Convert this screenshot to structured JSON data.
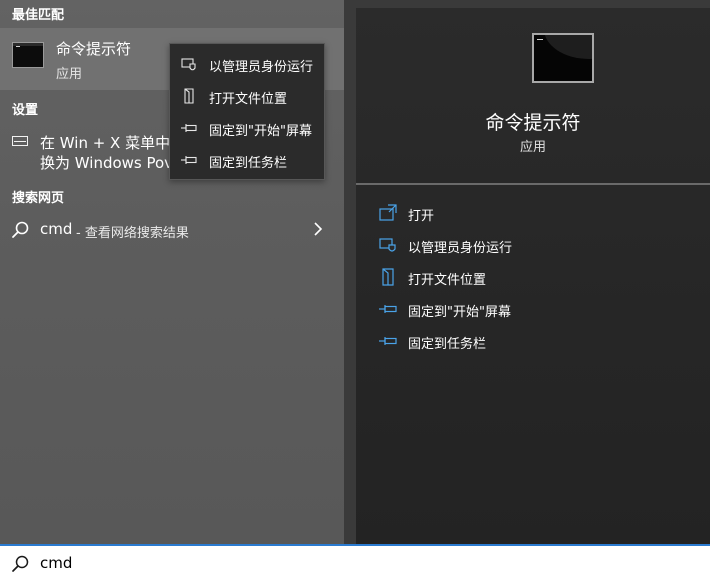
{
  "left": {
    "best_match_header": "最佳匹配",
    "best_match": {
      "title": "命令提示符",
      "subtitle": "应用",
      "icon": "command-prompt-icon"
    },
    "settings_header": "设置",
    "settings_result": {
      "line1": "在 Win + X 菜单中",
      "line2": "换为 Windows Pov",
      "icon": "settings-window-icon"
    },
    "web_header": "搜索网页",
    "web_result": {
      "query": "cmd",
      "suffix": "- 查看网络搜索结果",
      "icon": "search-icon"
    }
  },
  "context_menu": {
    "items": [
      {
        "label": "以管理员身份运行",
        "icon": "shield-icon"
      },
      {
        "label": "打开文件位置",
        "icon": "file-location-icon"
      },
      {
        "label": "固定到\"开始\"屏幕",
        "icon": "pin-icon"
      },
      {
        "label": "固定到任务栏",
        "icon": "pin-icon"
      }
    ]
  },
  "details": {
    "title": "命令提示符",
    "subtitle": "应用",
    "icon": "command-prompt-large-icon",
    "actions": [
      {
        "label": "打开",
        "icon": "open-icon"
      },
      {
        "label": "以管理员身份运行",
        "icon": "shield-icon"
      },
      {
        "label": "打开文件位置",
        "icon": "file-location-icon"
      },
      {
        "label": "固定到\"开始\"屏幕",
        "icon": "pin-icon"
      },
      {
        "label": "固定到任务栏",
        "icon": "pin-icon"
      }
    ]
  },
  "search": {
    "value": "cmd"
  },
  "colors": {
    "accent": "#4aa3e8",
    "search_focus_border": "#2b7bd0",
    "selected_row": "#717171",
    "context_menu_bg": "#2b2b2b",
    "detail_bg": "#2b2b2b"
  }
}
